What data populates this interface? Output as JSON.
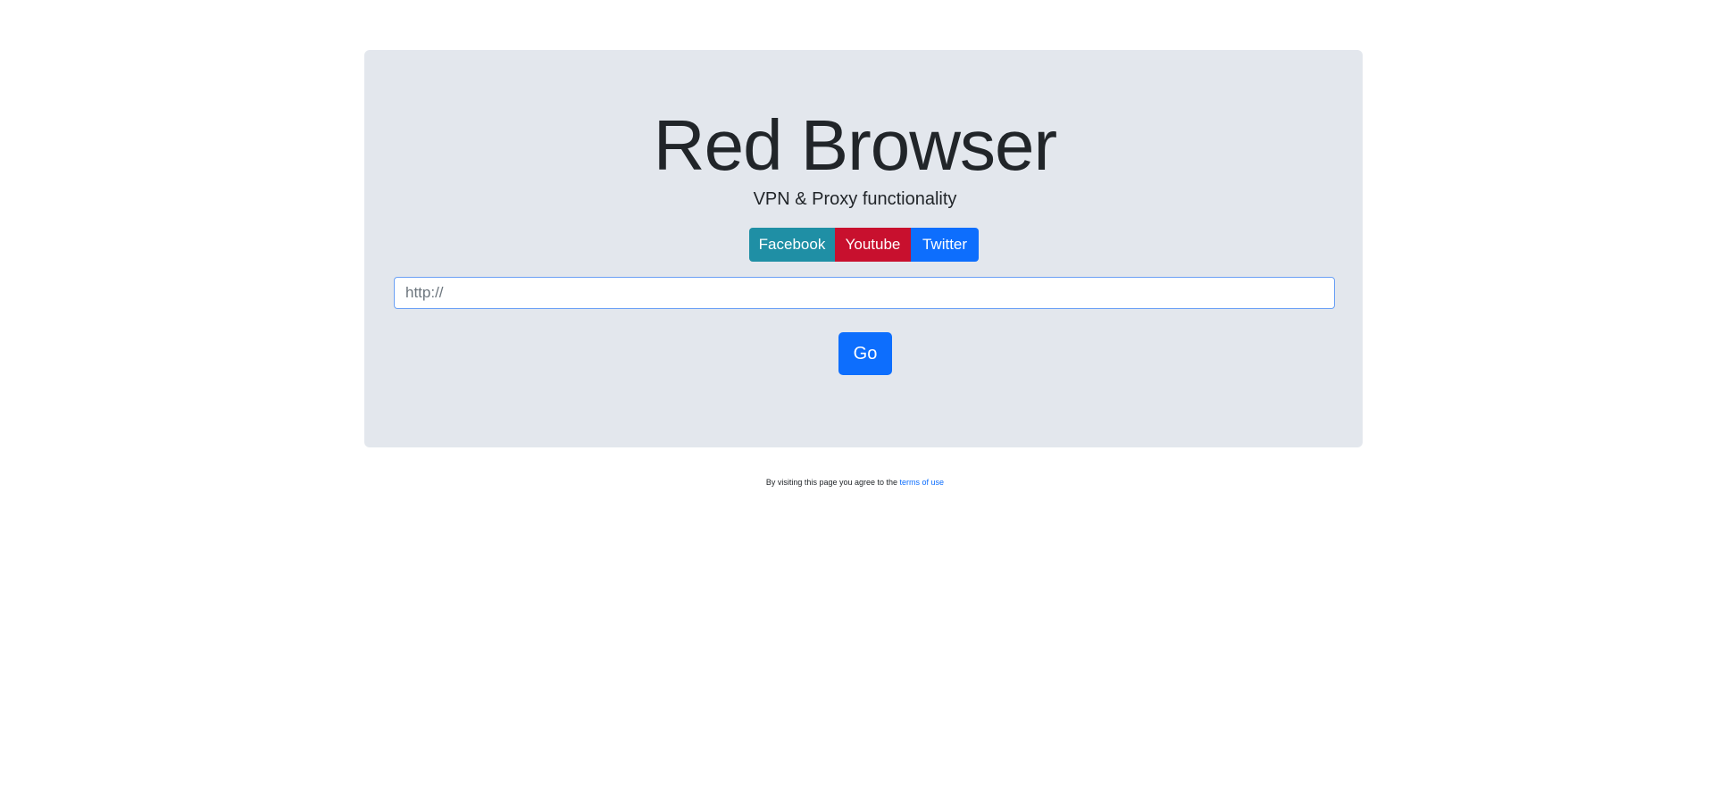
{
  "hero": {
    "title": "Red Browser",
    "subtitle": "VPN & Proxy functionality"
  },
  "shortcuts": [
    {
      "label": "Facebook",
      "color": "#1f8fa5"
    },
    {
      "label": "Youtube",
      "color": "#c8102e"
    },
    {
      "label": "Twitter",
      "color": "#0d6efd"
    }
  ],
  "url_input": {
    "placeholder": "http://",
    "value": ""
  },
  "go_button": {
    "label": "Go",
    "color": "#0d6efd"
  },
  "footer": {
    "text": "By visiting this page you agree to the",
    "link_text": "terms of use"
  }
}
